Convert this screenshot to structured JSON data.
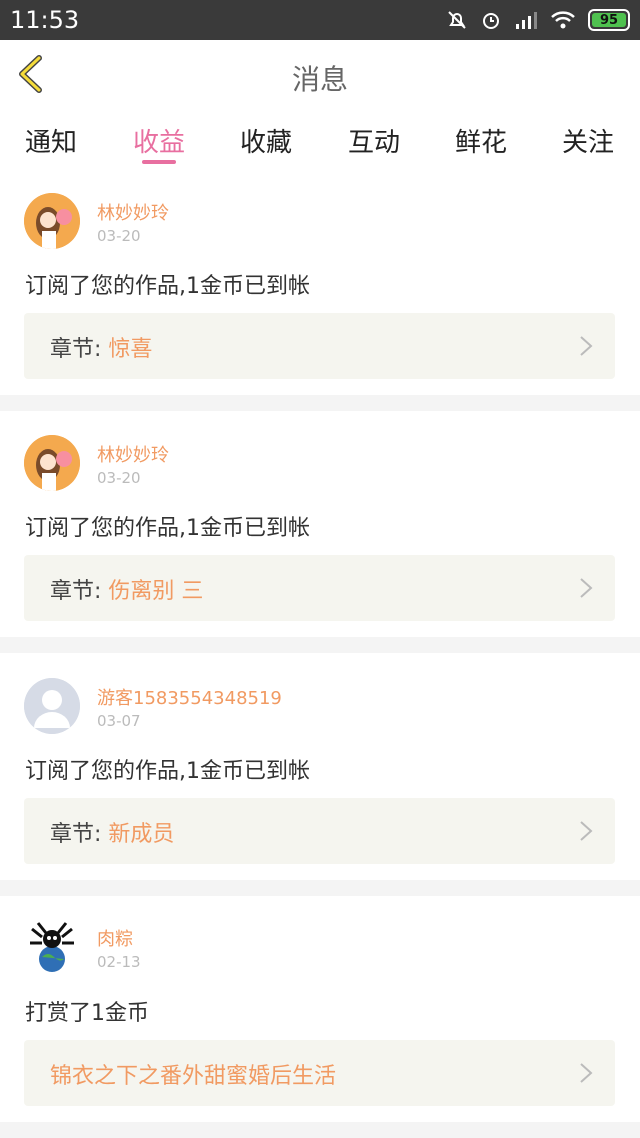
{
  "status_bar": {
    "time": "11:53",
    "battery": "95"
  },
  "header": {
    "title": "消息"
  },
  "tabs": [
    {
      "label": "通知"
    },
    {
      "label": "收益",
      "active": true
    },
    {
      "label": "收藏"
    },
    {
      "label": "互动"
    },
    {
      "label": "鲜花"
    },
    {
      "label": "关注"
    }
  ],
  "colors": {
    "accent_pink": "#e86fa0",
    "name_orange": "#f19a62",
    "battery_green": "#4fc14f"
  },
  "messages": [
    {
      "user": "林妙妙玲",
      "date": "03-20",
      "text": "订阅了您的作品,1金币已到帐",
      "chapter_label": "章节:",
      "chapter": "惊喜",
      "avatar": "cartoon-girl-avatar"
    },
    {
      "user": "林妙妙玲",
      "date": "03-20",
      "text": "订阅了您的作品,1金币已到帐",
      "chapter_label": "章节:",
      "chapter": "伤离别 三",
      "avatar": "cartoon-girl-avatar"
    },
    {
      "user": "游客1583554348519",
      "date": "03-07",
      "text": "订阅了您的作品,1金币已到帐",
      "chapter_label": "章节:",
      "chapter": "新成员",
      "avatar": "default-user-avatar"
    },
    {
      "user": "肉粽",
      "date": "02-13",
      "text": "打赏了1金币",
      "chapter_label": "",
      "chapter": "锦衣之下之番外甜蜜婚后生活",
      "avatar": "globe-character-avatar"
    }
  ]
}
